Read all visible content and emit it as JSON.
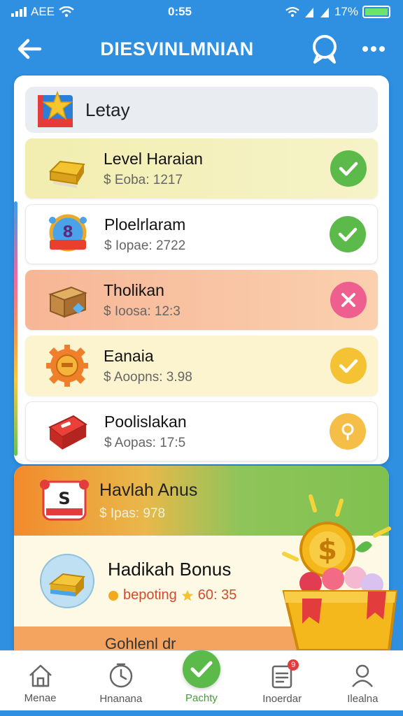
{
  "status_bar": {
    "carrier": "AEE",
    "time": "0:55",
    "battery_pct": "17%"
  },
  "app_bar": {
    "title": "DIESVINLMNIAN"
  },
  "card": {
    "header_title": "Letay",
    "tasks": [
      {
        "title": "Level Haraian",
        "sub": "$ Eoba: 1217",
        "status": "done",
        "bg": "#f3f0b8"
      },
      {
        "title": "Ploelrlaram",
        "sub": "$ Iopae: 2722",
        "status": "done",
        "bg": "#ffffff"
      },
      {
        "title": "Tholikan",
        "sub": "$ Ioosa: 12:3",
        "status": "failed",
        "bg": "#f9c5a5"
      },
      {
        "title": "Eanaia",
        "sub": "$ Aoopns: 3.98",
        "status": "pending",
        "bg": "#fcf4d2"
      },
      {
        "title": "Poolislakan",
        "sub": "$ Aopas: 17:5",
        "status": "locked",
        "bg": "#ffffff"
      }
    ]
  },
  "bonus": {
    "title": "Havlah Anus",
    "sub": "$ Ipas: 978",
    "title2": "Hadikah Bonus",
    "sub2_left": "bepoting",
    "sub2_right": "60: 35",
    "peek": "Gohlenl dr"
  },
  "nav": {
    "items": [
      {
        "label": "Menae",
        "icon": "home-icon"
      },
      {
        "label": "Hnanana",
        "icon": "timer-icon"
      },
      {
        "label": "Pachty",
        "icon": "check-icon"
      },
      {
        "label": "Inoerdar",
        "icon": "clipboard-icon"
      },
      {
        "label": "Ilealna",
        "icon": "profile-icon"
      }
    ],
    "badge_count": "9"
  },
  "colors": {
    "primary": "#2f8fe0",
    "success": "#5cba4a",
    "danger": "#ee5e8e",
    "warning": "#f5c233"
  }
}
